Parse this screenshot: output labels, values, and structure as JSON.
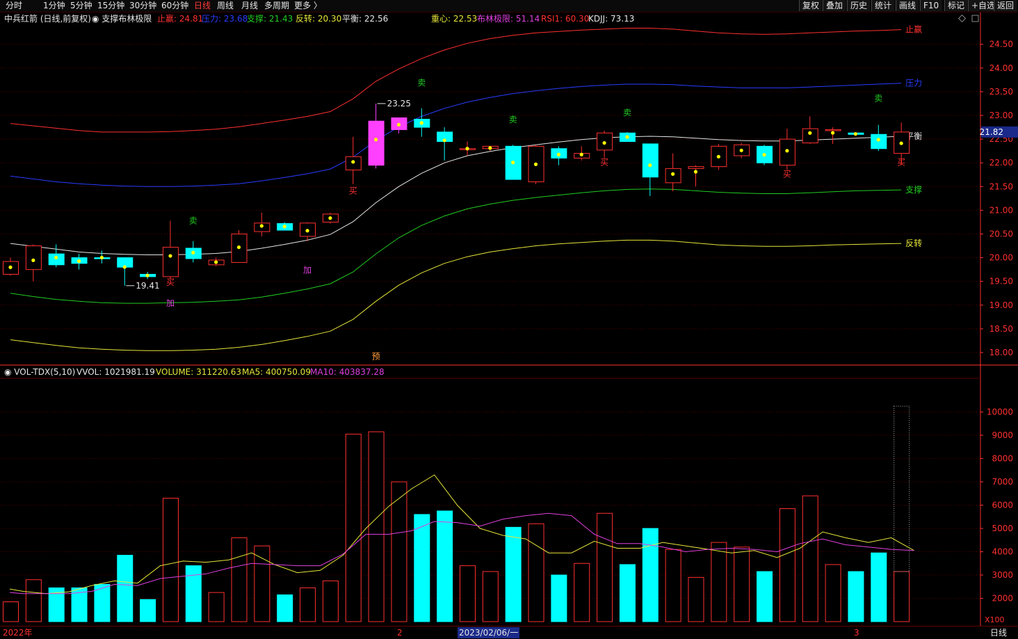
{
  "menu": {
    "periods": [
      "分时",
      "1分钟",
      "5分钟",
      "15分钟",
      "30分钟",
      "60分钟",
      "日线",
      "周线",
      "月线",
      "多周期",
      "更多 〉"
    ],
    "active_period": "日线",
    "tools": [
      "复权",
      "叠加",
      "历史",
      "统计",
      "画线",
      "F10",
      "标记",
      "+自选",
      "返回"
    ]
  },
  "main_legend": {
    "stock_name": "中兵红箭 (日线,前复权)",
    "indicator_name": "支撑布林极限",
    "items": [
      {
        "label": "止赢: 24.81",
        "color": "#ff3030"
      },
      {
        "label": "压力: 23.68",
        "color": "#2a3cff"
      },
      {
        "label": "支撑: 21.43",
        "color": "#22cc22"
      },
      {
        "label": "反转: 20.30",
        "color": "#e6e63a"
      },
      {
        "label": "平衡: 22.56",
        "color": "#e6e6e6"
      },
      {
        "label": "重心: 22.53",
        "color": "#e6e63a"
      },
      {
        "label": "布林极限: 51.14",
        "color": "#e040e0"
      },
      {
        "label": "RSI1: 60.30",
        "color": "#ff3030"
      },
      {
        "label": "KDJJ: 73.13",
        "color": "#e6e6e6"
      }
    ]
  },
  "volume_legend": {
    "name": "VOL-TDX(5,10)",
    "items": [
      {
        "label": "VVOL: 1021981.19",
        "color": "#e6e6e6"
      },
      {
        "label": "VOLUME: 311220.63",
        "color": "#e6e63a"
      },
      {
        "label": "MA5: 400750.09",
        "color": "#e6e63a"
      },
      {
        "label": "MA10: 403837.28",
        "color": "#e040e0"
      }
    ]
  },
  "price_badge": "21.82",
  "volume_unit": "X100",
  "bottom_bar": {
    "labels": [
      {
        "text": "2022年",
        "color": "#ff3030"
      },
      {
        "text": "2",
        "color": "#ff3030"
      },
      {
        "text": "2023/02/06/一",
        "color": "#e6e6e6"
      },
      {
        "text": "3",
        "color": "#ff3030"
      }
    ],
    "period_label": "日线"
  },
  "colors": {
    "up": "#ff3030",
    "down": "#00ffff",
    "grid": "#5a0000",
    "axis": "#ff3030",
    "background": "#000000"
  },
  "chart_data": [
    {
      "type": "candlestick",
      "title": "",
      "ylim": [
        17.85,
        24.9
      ],
      "yticks": [
        18.0,
        18.5,
        19.0,
        19.5,
        20.0,
        20.5,
        21.0,
        21.5,
        22.0,
        22.5,
        23.0,
        23.5,
        24.0,
        24.5
      ],
      "candles": [
        {
          "o": 19.65,
          "h": 20.0,
          "l": 19.62,
          "c": 19.92
        },
        {
          "o": 19.75,
          "h": 20.28,
          "l": 19.5,
          "c": 20.25
        },
        {
          "o": 20.08,
          "h": 20.28,
          "l": 19.8,
          "c": 19.85
        },
        {
          "o": 20.0,
          "h": 20.08,
          "l": 19.75,
          "c": 19.88
        },
        {
          "o": 20.0,
          "h": 20.15,
          "l": 19.88,
          "c": 19.98
        },
        {
          "o": 20.0,
          "h": 20.0,
          "l": 19.41,
          "c": 19.8
        },
        {
          "o": 19.65,
          "h": 19.7,
          "l": 19.55,
          "c": 19.6
        },
        {
          "o": 19.6,
          "h": 20.78,
          "l": 19.55,
          "c": 20.22
        },
        {
          "o": 20.2,
          "h": 20.35,
          "l": 19.9,
          "c": 19.98
        },
        {
          "o": 19.85,
          "h": 20.0,
          "l": 19.82,
          "c": 19.95
        },
        {
          "o": 19.9,
          "h": 20.58,
          "l": 19.9,
          "c": 20.5
        },
        {
          "o": 20.55,
          "h": 20.95,
          "l": 20.45,
          "c": 20.73
        },
        {
          "o": 20.72,
          "h": 20.75,
          "l": 20.58,
          "c": 20.58
        },
        {
          "o": 20.45,
          "h": 20.75,
          "l": 20.35,
          "c": 20.73
        },
        {
          "o": 20.75,
          "h": 20.95,
          "l": 20.72,
          "c": 20.92
        },
        {
          "o": 21.85,
          "h": 22.55,
          "l": 21.55,
          "c": 22.13
        },
        {
          "o": 21.95,
          "h": 23.25,
          "l": 21.88,
          "c": 22.88
        },
        {
          "o": 22.7,
          "h": 22.95,
          "l": 22.62,
          "c": 22.95
        },
        {
          "o": 22.92,
          "h": 23.15,
          "l": 22.55,
          "c": 22.75
        },
        {
          "o": 22.65,
          "h": 22.75,
          "l": 22.05,
          "c": 22.45
        },
        {
          "o": 22.3,
          "h": 22.45,
          "l": 22.15,
          "c": 22.3
        },
        {
          "o": 22.3,
          "h": 22.35,
          "l": 22.25,
          "c": 22.35
        },
        {
          "o": 22.35,
          "h": 22.38,
          "l": 21.65,
          "c": 21.65
        },
        {
          "o": 21.6,
          "h": 22.38,
          "l": 21.55,
          "c": 22.35
        },
        {
          "o": 22.3,
          "h": 22.35,
          "l": 21.95,
          "c": 22.1
        },
        {
          "o": 22.1,
          "h": 22.35,
          "l": 22.05,
          "c": 22.2
        },
        {
          "o": 22.27,
          "h": 22.68,
          "l": 22.1,
          "c": 22.63
        },
        {
          "o": 22.63,
          "h": 22.65,
          "l": 22.45,
          "c": 22.45
        },
        {
          "o": 22.4,
          "h": 22.4,
          "l": 21.3,
          "c": 21.7
        },
        {
          "o": 21.58,
          "h": 22.2,
          "l": 21.4,
          "c": 21.88
        },
        {
          "o": 21.88,
          "h": 21.95,
          "l": 21.5,
          "c": 21.92
        },
        {
          "o": 21.92,
          "h": 22.4,
          "l": 21.85,
          "c": 22.35
        },
        {
          "o": 22.15,
          "h": 22.42,
          "l": 22.1,
          "c": 22.38
        },
        {
          "o": 22.35,
          "h": 22.38,
          "l": 21.95,
          "c": 22.0
        },
        {
          "o": 21.95,
          "h": 22.72,
          "l": 21.85,
          "c": 22.5
        },
        {
          "o": 22.42,
          "h": 22.98,
          "l": 22.4,
          "c": 22.72
        },
        {
          "o": 22.68,
          "h": 22.75,
          "l": 22.4,
          "c": 22.7
        },
        {
          "o": 22.63,
          "h": 22.63,
          "l": 22.58,
          "c": 22.6
        },
        {
          "o": 22.6,
          "h": 22.8,
          "l": 22.25,
          "c": 22.3
        },
        {
          "o": 22.2,
          "h": 22.85,
          "l": 21.95,
          "c": 22.65
        }
      ],
      "series": [
        {
          "name": "止赢",
          "color": "#ff3030",
          "values": [
            22.83,
            22.78,
            22.73,
            22.68,
            22.65,
            22.65,
            22.65,
            22.66,
            22.68,
            22.71,
            22.76,
            22.83,
            22.9,
            22.98,
            23.08,
            23.35,
            23.72,
            23.98,
            24.2,
            24.38,
            24.52,
            24.62,
            24.69,
            24.74,
            24.77,
            24.8,
            24.82,
            24.84,
            24.84,
            24.82,
            24.78,
            24.74,
            24.72,
            24.71,
            24.72,
            24.74,
            24.76,
            24.78,
            24.79,
            24.81
          ]
        },
        {
          "name": "压力",
          "color": "#2a3cff",
          "values": [
            21.72,
            21.66,
            21.6,
            21.56,
            21.53,
            21.51,
            21.5,
            21.5,
            21.51,
            21.53,
            21.56,
            21.62,
            21.69,
            21.77,
            21.87,
            22.12,
            22.47,
            22.76,
            22.98,
            23.15,
            23.28,
            23.38,
            23.46,
            23.52,
            23.57,
            23.61,
            23.64,
            23.66,
            23.66,
            23.65,
            23.62,
            23.6,
            23.58,
            23.58,
            23.58,
            23.6,
            23.62,
            23.64,
            23.66,
            23.68
          ]
        },
        {
          "name": "平衡",
          "color": "#e6e6e6",
          "values": [
            20.3,
            20.24,
            20.18,
            20.12,
            20.09,
            20.07,
            20.06,
            20.06,
            20.07,
            20.09,
            20.13,
            20.2,
            20.28,
            20.37,
            20.49,
            20.76,
            21.16,
            21.5,
            21.78,
            22.0,
            22.15,
            22.24,
            22.32,
            22.38,
            22.44,
            22.49,
            22.53,
            22.55,
            22.56,
            22.55,
            22.52,
            22.49,
            22.47,
            22.46,
            22.46,
            22.48,
            22.5,
            22.52,
            22.54,
            22.56
          ]
        },
        {
          "name": "支撑",
          "color": "#22cc22",
          "values": [
            19.25,
            19.18,
            19.12,
            19.08,
            19.05,
            19.04,
            19.04,
            19.05,
            19.06,
            19.08,
            19.11,
            19.17,
            19.25,
            19.34,
            19.45,
            19.7,
            20.08,
            20.42,
            20.68,
            20.88,
            21.03,
            21.13,
            21.21,
            21.27,
            21.32,
            21.37,
            21.41,
            21.44,
            21.45,
            21.44,
            21.41,
            21.38,
            21.36,
            21.35,
            21.35,
            21.37,
            21.39,
            21.41,
            21.42,
            21.43
          ]
        },
        {
          "name": "反转",
          "color": "#e6e63a",
          "values": [
            18.27,
            18.21,
            18.15,
            18.1,
            18.07,
            18.05,
            18.04,
            18.04,
            18.05,
            18.07,
            18.11,
            18.17,
            18.25,
            18.34,
            18.45,
            18.7,
            19.08,
            19.42,
            19.68,
            19.88,
            20.02,
            20.12,
            20.19,
            20.25,
            20.29,
            20.32,
            20.35,
            20.37,
            20.37,
            20.35,
            20.31,
            20.27,
            20.25,
            20.24,
            20.24,
            20.25,
            20.27,
            20.28,
            20.29,
            20.3
          ]
        }
      ],
      "markers": [
        {
          "text": "卖",
          "index": 8,
          "price": 20.72,
          "color": "#22cc22"
        },
        {
          "text": "加",
          "index": 7,
          "price": 18.98,
          "color": "#e040e0"
        },
        {
          "text": "买",
          "index": 7,
          "price": 19.42,
          "color": "#ff3030"
        },
        {
          "text": "加",
          "index": 13,
          "price": 19.68,
          "color": "#e040e0"
        },
        {
          "text": "买",
          "index": 15,
          "price": 21.35,
          "color": "#ff3030"
        },
        {
          "text": "卖",
          "index": 18,
          "price": 23.63,
          "color": "#22cc22"
        },
        {
          "text": "卖",
          "index": 22,
          "price": 22.85,
          "color": "#22cc22"
        },
        {
          "text": "买",
          "index": 26,
          "price": 21.95,
          "color": "#ff3030"
        },
        {
          "text": "卖",
          "index": 27,
          "price": 23.0,
          "color": "#22cc22"
        },
        {
          "text": "买",
          "index": 34,
          "price": 21.7,
          "color": "#ff3030"
        },
        {
          "text": "卖",
          "index": 38,
          "price": 23.3,
          "color": "#22cc22"
        },
        {
          "text": "买",
          "index": 39,
          "price": 21.95,
          "color": "#ff3030"
        },
        {
          "text": "预",
          "index": 16,
          "price": 17.86,
          "color": "#ff9a3a"
        }
      ],
      "annotations": [
        {
          "text": "23.25",
          "index": 16,
          "price": 23.25
        },
        {
          "text": "19.41",
          "index": 5,
          "price": 19.41
        }
      ],
      "line_end_labels": [
        "止赢",
        "压力",
        "平衡",
        "支撑",
        "反转"
      ]
    },
    {
      "type": "bar",
      "title": "",
      "ylim": [
        1000,
        10500
      ],
      "yticks": [
        2000,
        3000,
        4000,
        5000,
        6000,
        7000,
        8000,
        9000,
        10000
      ],
      "values": [
        1850,
        2800,
        2450,
        2450,
        2600,
        3850,
        1950,
        6300,
        3400,
        2250,
        4600,
        4250,
        2150,
        2450,
        2750,
        9050,
        9150,
        7000,
        5600,
        5750,
        3400,
        3150,
        5050,
        5200,
        3000,
        3500,
        5650,
        3450,
        5000,
        4100,
        2900,
        4400,
        4200,
        3150,
        5850,
        6400,
        3450,
        3150,
        3950,
        3150
      ],
      "partial_last_bar": 10250,
      "ma5": [
        2400,
        2300,
        2200,
        2280,
        2550,
        2750,
        2650,
        3400,
        3600,
        3550,
        3650,
        3950,
        3450,
        3100,
        3200,
        3850,
        5000,
        5950,
        6700,
        7300,
        6000,
        5000,
        4700,
        4550,
        3950,
        3950,
        4450,
        4150,
        4150,
        4400,
        4250,
        4100,
        3950,
        4050,
        3750,
        4150,
        4850,
        4600,
        4400,
        4600,
        4050
      ],
      "ma10": [
        2250,
        2200,
        2200,
        2200,
        2300,
        2600,
        2550,
        2850,
        2950,
        3050,
        3300,
        3500,
        3450,
        3400,
        3400,
        3900,
        4750,
        4750,
        4900,
        5300,
        5250,
        5100,
        5400,
        5550,
        5650,
        5550,
        4750,
        4350,
        4350,
        4200,
        4000,
        4100,
        4150,
        4100,
        4000,
        4350,
        4550,
        4300,
        4200,
        4100,
        4050
      ]
    }
  ]
}
